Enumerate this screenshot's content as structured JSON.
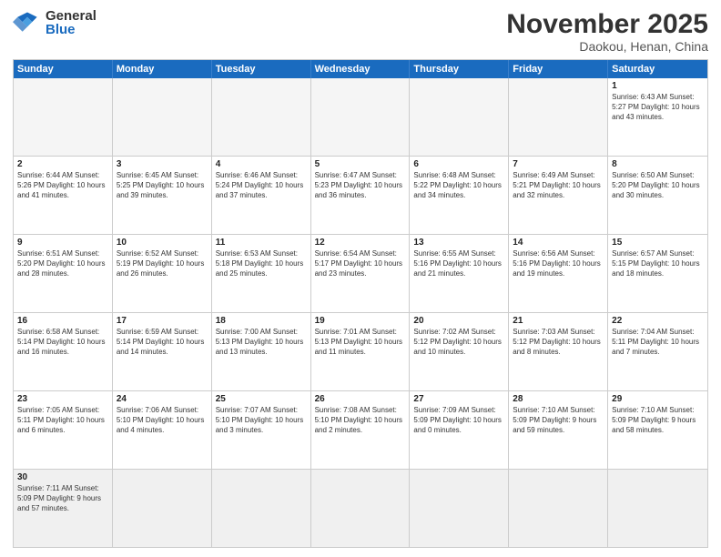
{
  "logo": {
    "general": "General",
    "blue": "Blue"
  },
  "header": {
    "month": "November 2025",
    "location": "Daokou, Henan, China"
  },
  "days": [
    "Sunday",
    "Monday",
    "Tuesday",
    "Wednesday",
    "Thursday",
    "Friday",
    "Saturday"
  ],
  "weeks": [
    [
      {
        "day": "",
        "info": "",
        "empty": true
      },
      {
        "day": "",
        "info": "",
        "empty": true
      },
      {
        "day": "",
        "info": "",
        "empty": true
      },
      {
        "day": "",
        "info": "",
        "empty": true
      },
      {
        "day": "",
        "info": "",
        "empty": true
      },
      {
        "day": "",
        "info": "",
        "empty": true
      },
      {
        "day": "1",
        "info": "Sunrise: 6:43 AM\nSunset: 5:27 PM\nDaylight: 10 hours and 43 minutes.",
        "empty": false
      }
    ],
    [
      {
        "day": "2",
        "info": "Sunrise: 6:44 AM\nSunset: 5:26 PM\nDaylight: 10 hours and 41 minutes.",
        "empty": false
      },
      {
        "day": "3",
        "info": "Sunrise: 6:45 AM\nSunset: 5:25 PM\nDaylight: 10 hours and 39 minutes.",
        "empty": false
      },
      {
        "day": "4",
        "info": "Sunrise: 6:46 AM\nSunset: 5:24 PM\nDaylight: 10 hours and 37 minutes.",
        "empty": false
      },
      {
        "day": "5",
        "info": "Sunrise: 6:47 AM\nSunset: 5:23 PM\nDaylight: 10 hours and 36 minutes.",
        "empty": false
      },
      {
        "day": "6",
        "info": "Sunrise: 6:48 AM\nSunset: 5:22 PM\nDaylight: 10 hours and 34 minutes.",
        "empty": false
      },
      {
        "day": "7",
        "info": "Sunrise: 6:49 AM\nSunset: 5:21 PM\nDaylight: 10 hours and 32 minutes.",
        "empty": false
      },
      {
        "day": "8",
        "info": "Sunrise: 6:50 AM\nSunset: 5:20 PM\nDaylight: 10 hours and 30 minutes.",
        "empty": false
      }
    ],
    [
      {
        "day": "9",
        "info": "Sunrise: 6:51 AM\nSunset: 5:20 PM\nDaylight: 10 hours and 28 minutes.",
        "empty": false
      },
      {
        "day": "10",
        "info": "Sunrise: 6:52 AM\nSunset: 5:19 PM\nDaylight: 10 hours and 26 minutes.",
        "empty": false
      },
      {
        "day": "11",
        "info": "Sunrise: 6:53 AM\nSunset: 5:18 PM\nDaylight: 10 hours and 25 minutes.",
        "empty": false
      },
      {
        "day": "12",
        "info": "Sunrise: 6:54 AM\nSunset: 5:17 PM\nDaylight: 10 hours and 23 minutes.",
        "empty": false
      },
      {
        "day": "13",
        "info": "Sunrise: 6:55 AM\nSunset: 5:16 PM\nDaylight: 10 hours and 21 minutes.",
        "empty": false
      },
      {
        "day": "14",
        "info": "Sunrise: 6:56 AM\nSunset: 5:16 PM\nDaylight: 10 hours and 19 minutes.",
        "empty": false
      },
      {
        "day": "15",
        "info": "Sunrise: 6:57 AM\nSunset: 5:15 PM\nDaylight: 10 hours and 18 minutes.",
        "empty": false
      }
    ],
    [
      {
        "day": "16",
        "info": "Sunrise: 6:58 AM\nSunset: 5:14 PM\nDaylight: 10 hours and 16 minutes.",
        "empty": false
      },
      {
        "day": "17",
        "info": "Sunrise: 6:59 AM\nSunset: 5:14 PM\nDaylight: 10 hours and 14 minutes.",
        "empty": false
      },
      {
        "day": "18",
        "info": "Sunrise: 7:00 AM\nSunset: 5:13 PM\nDaylight: 10 hours and 13 minutes.",
        "empty": false
      },
      {
        "day": "19",
        "info": "Sunrise: 7:01 AM\nSunset: 5:13 PM\nDaylight: 10 hours and 11 minutes.",
        "empty": false
      },
      {
        "day": "20",
        "info": "Sunrise: 7:02 AM\nSunset: 5:12 PM\nDaylight: 10 hours and 10 minutes.",
        "empty": false
      },
      {
        "day": "21",
        "info": "Sunrise: 7:03 AM\nSunset: 5:12 PM\nDaylight: 10 hours and 8 minutes.",
        "empty": false
      },
      {
        "day": "22",
        "info": "Sunrise: 7:04 AM\nSunset: 5:11 PM\nDaylight: 10 hours and 7 minutes.",
        "empty": false
      }
    ],
    [
      {
        "day": "23",
        "info": "Sunrise: 7:05 AM\nSunset: 5:11 PM\nDaylight: 10 hours and 6 minutes.",
        "empty": false
      },
      {
        "day": "24",
        "info": "Sunrise: 7:06 AM\nSunset: 5:10 PM\nDaylight: 10 hours and 4 minutes.",
        "empty": false
      },
      {
        "day": "25",
        "info": "Sunrise: 7:07 AM\nSunset: 5:10 PM\nDaylight: 10 hours and 3 minutes.",
        "empty": false
      },
      {
        "day": "26",
        "info": "Sunrise: 7:08 AM\nSunset: 5:10 PM\nDaylight: 10 hours and 2 minutes.",
        "empty": false
      },
      {
        "day": "27",
        "info": "Sunrise: 7:09 AM\nSunset: 5:09 PM\nDaylight: 10 hours and 0 minutes.",
        "empty": false
      },
      {
        "day": "28",
        "info": "Sunrise: 7:10 AM\nSunset: 5:09 PM\nDaylight: 9 hours and 59 minutes.",
        "empty": false
      },
      {
        "day": "29",
        "info": "Sunrise: 7:10 AM\nSunset: 5:09 PM\nDaylight: 9 hours and 58 minutes.",
        "empty": false
      }
    ],
    [
      {
        "day": "30",
        "info": "Sunrise: 7:11 AM\nSunset: 5:09 PM\nDaylight: 9 hours and 57 minutes.",
        "empty": false
      },
      {
        "day": "",
        "info": "",
        "empty": true
      },
      {
        "day": "",
        "info": "",
        "empty": true
      },
      {
        "day": "",
        "info": "",
        "empty": true
      },
      {
        "day": "",
        "info": "",
        "empty": true
      },
      {
        "day": "",
        "info": "",
        "empty": true
      },
      {
        "day": "",
        "info": "",
        "empty": true
      }
    ]
  ]
}
